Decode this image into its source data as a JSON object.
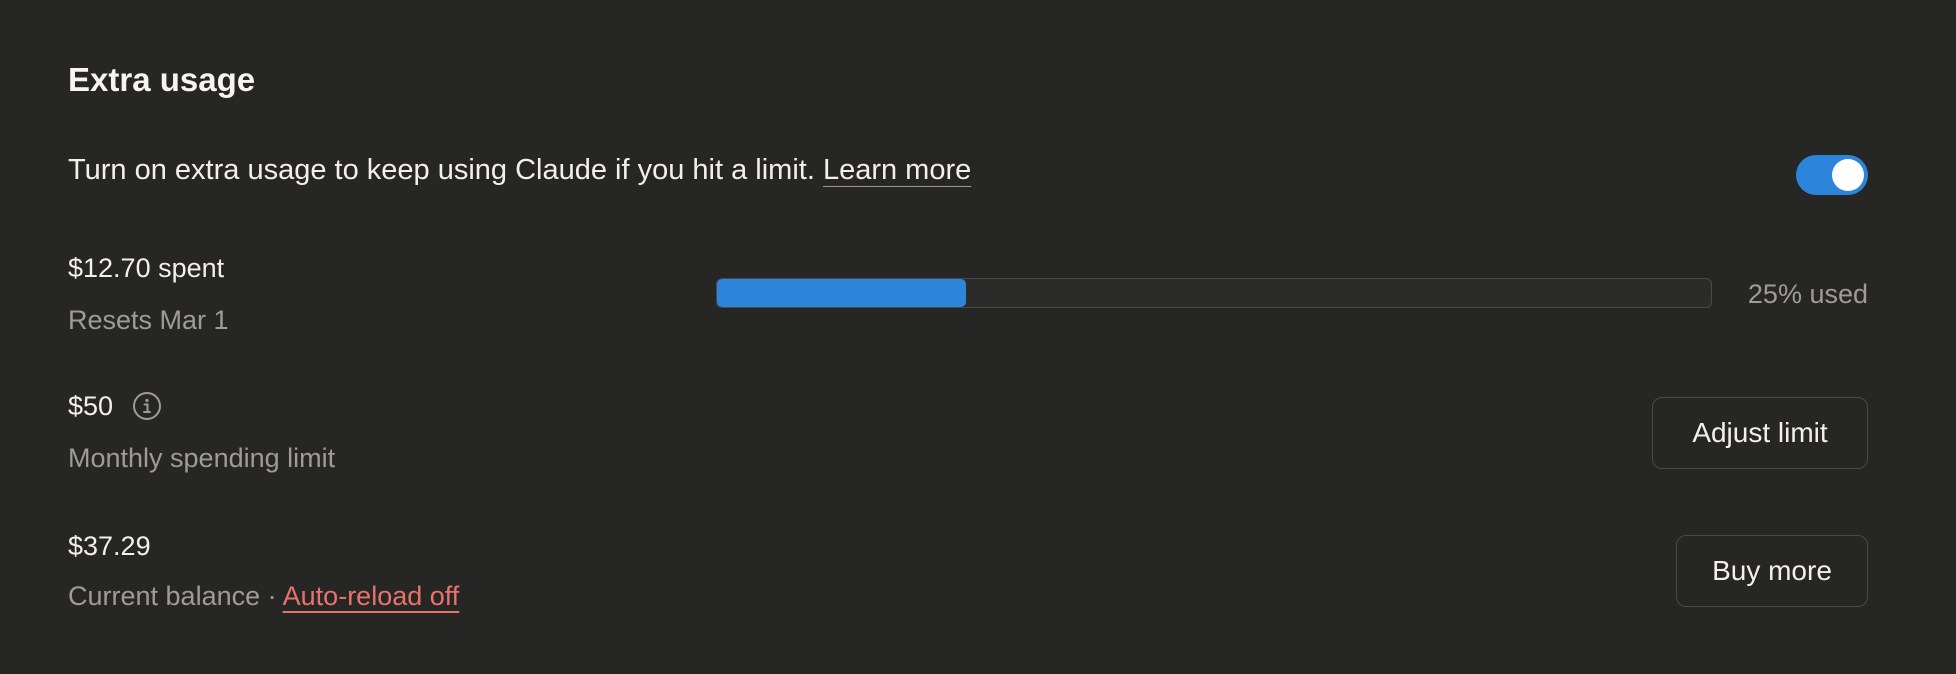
{
  "section": {
    "title": "Extra usage"
  },
  "intro": {
    "text": "Turn on extra usage to keep using Claude if you hit a limit. ",
    "learn_more": "Learn more",
    "toggle_on": true
  },
  "spent": {
    "amount": "$12.70 spent",
    "resets": "Resets Mar 1",
    "used_fraction": 0.25,
    "used_label": "25% used"
  },
  "limit": {
    "amount": "$50",
    "description": "Monthly spending limit",
    "button_label": "Adjust limit"
  },
  "balance": {
    "amount": "$37.29",
    "description": "Current balance",
    "separator": "·",
    "auto_reload": "Auto-reload off",
    "button_label": "Buy more"
  },
  "colors": {
    "background": "#262624",
    "accent": "#2c84db",
    "warning_link": "#e9726c"
  },
  "icons": {
    "info": "info-icon"
  }
}
